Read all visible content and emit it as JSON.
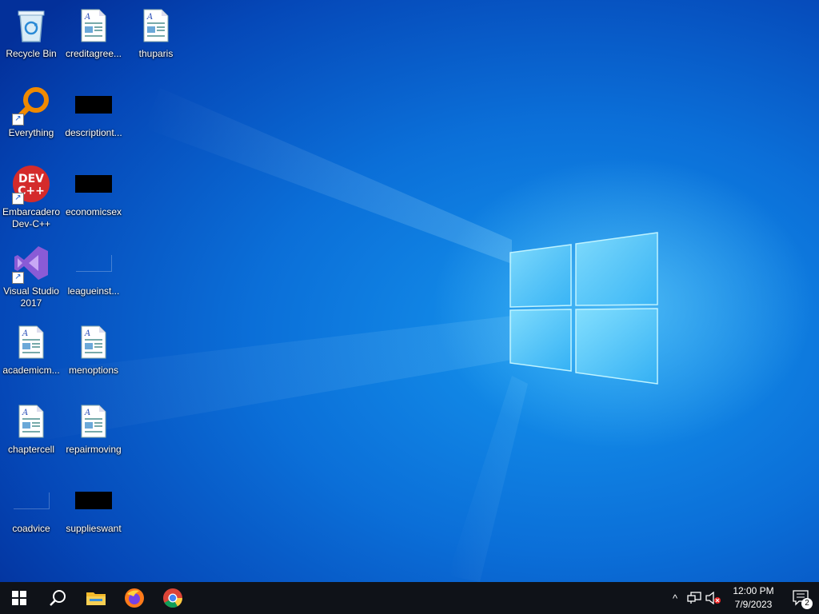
{
  "desktop": {
    "icons": [
      {
        "label": "Recycle Bin",
        "icon": "recycle-bin-icon"
      },
      {
        "label": "creditagree...",
        "icon": "document-icon"
      },
      {
        "label": "thuparis",
        "icon": "document-icon"
      },
      {
        "label": "Everything",
        "icon": "everything-search-icon",
        "shortcut": true
      },
      {
        "label": "descriptiont...",
        "icon": "redacted-thumbnail"
      },
      {
        "label": "Embarcadero Dev-C++",
        "icon": "devcpp-icon",
        "shortcut": true,
        "icon_text": "DEV C++"
      },
      {
        "label": "economicsex",
        "icon": "redacted-thumbnail"
      },
      {
        "label": "Visual Studio 2017",
        "icon": "visual-studio-icon",
        "shortcut": true
      },
      {
        "label": "leagueinst...",
        "icon": "blank-thumbnail"
      },
      {
        "label": "academicm...",
        "icon": "document-icon"
      },
      {
        "label": "menoptions",
        "icon": "document-icon"
      },
      {
        "label": "chaptercell",
        "icon": "document-icon"
      },
      {
        "label": "repairmoving",
        "icon": "document-icon"
      },
      {
        "label": "coadvice",
        "icon": "blank-thumbnail"
      },
      {
        "label": "supplieswant",
        "icon": "redacted-thumbnail"
      }
    ]
  },
  "taskbar": {
    "buttons": [
      {
        "name": "start-button",
        "icon": "windows-start-icon"
      },
      {
        "name": "search-button",
        "icon": "search-icon"
      },
      {
        "name": "file-explorer-button",
        "icon": "folder-icon"
      },
      {
        "name": "firefox-button",
        "icon": "firefox-icon"
      },
      {
        "name": "chrome-button",
        "icon": "chrome-icon"
      }
    ],
    "tray": {
      "chevron": "^",
      "time": "12:00 PM",
      "date": "7/9/2023",
      "notification_count": "2"
    }
  },
  "colors": {
    "taskbar": "#0f1218",
    "desktop_accent": "#0b6fd8"
  }
}
